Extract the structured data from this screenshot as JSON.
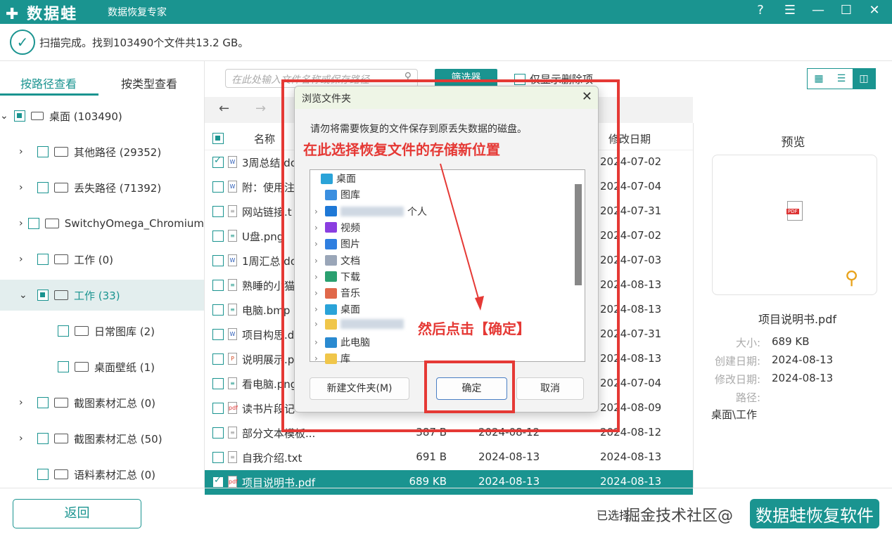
{
  "app": {
    "logo": "✚ 数据蛙",
    "subtitle": "数据恢复专家",
    "window_buttons": [
      "help-icon",
      "menu-icon",
      "minimize-icon",
      "maximize-icon",
      "close-icon"
    ]
  },
  "status": {
    "text": "扫描完成。找到103490个文件共13.2 GB。"
  },
  "tabs": [
    "按路径查看",
    "按类型查看"
  ],
  "tree": [
    {
      "label": "桌面 (103490)",
      "level": 0,
      "expanded": true,
      "state": "partial",
      "icon": "drive"
    },
    {
      "label": "其他路径 (29352)",
      "level": 1,
      "state": "none"
    },
    {
      "label": "丢失路径 (71392)",
      "level": 1,
      "state": "none"
    },
    {
      "label": "SwitchyOmega_Chromium",
      "level": 1,
      "state": "none"
    },
    {
      "label": "工作 (0)",
      "level": 1,
      "state": "none"
    },
    {
      "label": "工作 (33)",
      "level": 1,
      "state": "partial",
      "selected": true,
      "expanded": true
    },
    {
      "label": "日常图库 (2)",
      "level": 2,
      "state": "none"
    },
    {
      "label": "桌面壁纸 (1)",
      "level": 2,
      "state": "none"
    },
    {
      "label": "截图素材汇总 (0)",
      "level": 1,
      "state": "none"
    },
    {
      "label": "截图素材汇总 (50)",
      "level": 1,
      "state": "none"
    },
    {
      "label": "语料素材汇总 (0)",
      "level": 1,
      "state": "none",
      "nochev": true
    }
  ],
  "toolbar": {
    "search_placeholder": "在此处输入文件名称或保存路径",
    "filter": "筛选器",
    "deleted_only": "仅显示删除项"
  },
  "columns": {
    "name": "名称",
    "modified": "修改日期"
  },
  "files": [
    {
      "name": "3周总结.do",
      "type": "W",
      "size": "",
      "created": "",
      "modified": "2024-07-02",
      "checked": true
    },
    {
      "name": "附：使用注",
      "type": "W",
      "size": "",
      "created": "",
      "modified": "2024-07-04"
    },
    {
      "name": "网站链接.t",
      "type": "txt",
      "size": "",
      "created": "",
      "modified": "2024-07-31"
    },
    {
      "name": "U盘.png",
      "type": "img",
      "size": "",
      "created": "",
      "modified": "2024-07-02"
    },
    {
      "name": "1周汇总.do",
      "type": "W",
      "size": "",
      "created": "",
      "modified": "2024-07-03"
    },
    {
      "name": "熟睡的小猫",
      "type": "img",
      "size": "",
      "created": "",
      "modified": "2024-08-13"
    },
    {
      "name": "电脑.bmp",
      "type": "img",
      "size": "",
      "created": "",
      "modified": "2024-08-13"
    },
    {
      "name": "项目构思.d",
      "type": "W",
      "size": "",
      "created": "",
      "modified": "2024-07-31"
    },
    {
      "name": "说明展示.p",
      "type": "P",
      "size": "",
      "created": "",
      "modified": "2024-08-13"
    },
    {
      "name": "看电脑.png",
      "type": "img",
      "size": "",
      "created": "",
      "modified": "2024-07-04"
    },
    {
      "name": "读书片段记",
      "type": "pdf",
      "size": "",
      "created": "",
      "modified": "2024-08-09"
    },
    {
      "name": "部分文本模板...",
      "type": "txt",
      "size": "387  B",
      "created": "2024-08-12",
      "modified": "2024-08-12"
    },
    {
      "name": "自我介绍.txt",
      "type": "txt",
      "size": "691  B",
      "created": "2024-08-13",
      "modified": "2024-08-13"
    },
    {
      "name": "项目说明书.pdf",
      "type": "pdf",
      "size": "689 KB",
      "created": "2024-08-13",
      "modified": "2024-08-13",
      "checked": true,
      "selected": true
    }
  ],
  "preview": {
    "title": "预览",
    "filename": "项目说明书.pdf",
    "size_label": "大小:",
    "size": "689 KB",
    "created_label": "创建日期:",
    "created": "2024-08-13",
    "modified_label": "修改日期:",
    "modified": "2024-08-13",
    "path_label": "路径:",
    "path": "桌面\\工作"
  },
  "bottom": {
    "back": "返回",
    "selected_info": "已选择",
    "watermark_left": "掘金技术社区@",
    "watermark_right": "数据蛙恢复软件"
  },
  "dialog": {
    "title": "浏览文件夹",
    "warning": "请勿将需要恢复的文件保存到原丢失数据的磁盘。",
    "annotation_top": "在此选择恢复文件的存储新位置",
    "annotation_ok": "然后点击【确定】",
    "tree": [
      {
        "label": "桌面",
        "icon": "#2aa3d8",
        "chev": false,
        "indent": 0
      },
      {
        "label": "图库",
        "icon": "#3b8fe0",
        "chev": false,
        "indent": 1
      },
      {
        "label": "个人",
        "icon": "#1e78d6",
        "chev": true,
        "indent": 1,
        "blurred": true
      },
      {
        "label": "视频",
        "icon": "#8a3ee0",
        "chev": true,
        "indent": 1
      },
      {
        "label": "图片",
        "icon": "#2f7fe0",
        "chev": true,
        "indent": 1
      },
      {
        "label": "文档",
        "icon": "#9aa6b8",
        "chev": true,
        "indent": 1
      },
      {
        "label": "下载",
        "icon": "#2aa070",
        "chev": true,
        "indent": 1
      },
      {
        "label": "音乐",
        "icon": "#e0684a",
        "chev": true,
        "indent": 1
      },
      {
        "label": "桌面",
        "icon": "#2aa3d8",
        "chev": true,
        "indent": 1
      },
      {
        "label": "",
        "icon": "#f0c64a",
        "chev": true,
        "indent": 1,
        "blurred": true
      },
      {
        "label": "此电脑",
        "icon": "#2a8ad0",
        "chev": true,
        "indent": 1
      },
      {
        "label": "库",
        "icon": "#f0c64a",
        "chev": true,
        "indent": 1
      }
    ],
    "new_folder": "新建文件夹(M)",
    "ok": "确定",
    "cancel": "取消"
  },
  "colors": {
    "accent": "#1a9490",
    "annotation": "#e53935"
  }
}
